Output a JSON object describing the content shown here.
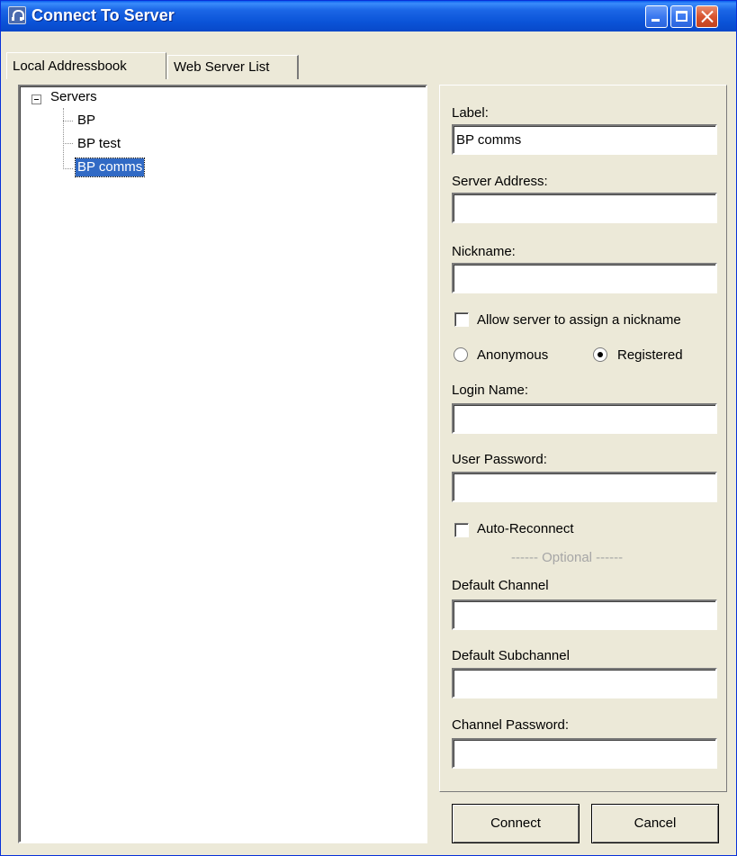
{
  "window": {
    "title": "Connect To Server"
  },
  "tabs": [
    {
      "label": "Local Addressbook",
      "active": true
    },
    {
      "label": "Web Server List",
      "active": false
    }
  ],
  "tree": {
    "root": "Servers",
    "items": [
      {
        "label": "BP",
        "selected": false
      },
      {
        "label": "BP test",
        "selected": false
      },
      {
        "label": "BP comms",
        "selected": true
      }
    ]
  },
  "form": {
    "label_label": "Label:",
    "label_value": "BP comms",
    "server_address_label": "Server Address:",
    "server_address_value": "",
    "nickname_label": "Nickname:",
    "nickname_value": "",
    "allow_nickname_label": "Allow server to assign a nickname",
    "allow_nickname_checked": false,
    "anonymous_label": "Anonymous",
    "registered_label": "Registered",
    "selected_mode": "Registered",
    "login_name_label": "Login Name:",
    "login_name_value": "",
    "user_password_label": "User Password:",
    "user_password_value": "",
    "auto_reconnect_label": "Auto-Reconnect",
    "auto_reconnect_checked": false,
    "optional_separator": "------ Optional ------",
    "default_channel_label": "Default Channel",
    "default_channel_value": "",
    "default_subchannel_label": "Default Subchannel",
    "default_subchannel_value": "",
    "channel_password_label": "Channel Password:",
    "channel_password_value": ""
  },
  "buttons": {
    "connect_label": "Connect",
    "cancel_label": "Cancel"
  },
  "colors": {
    "titlebar": "#0A53D7",
    "face": "#ECE9D8",
    "selection": "#316AC5"
  }
}
